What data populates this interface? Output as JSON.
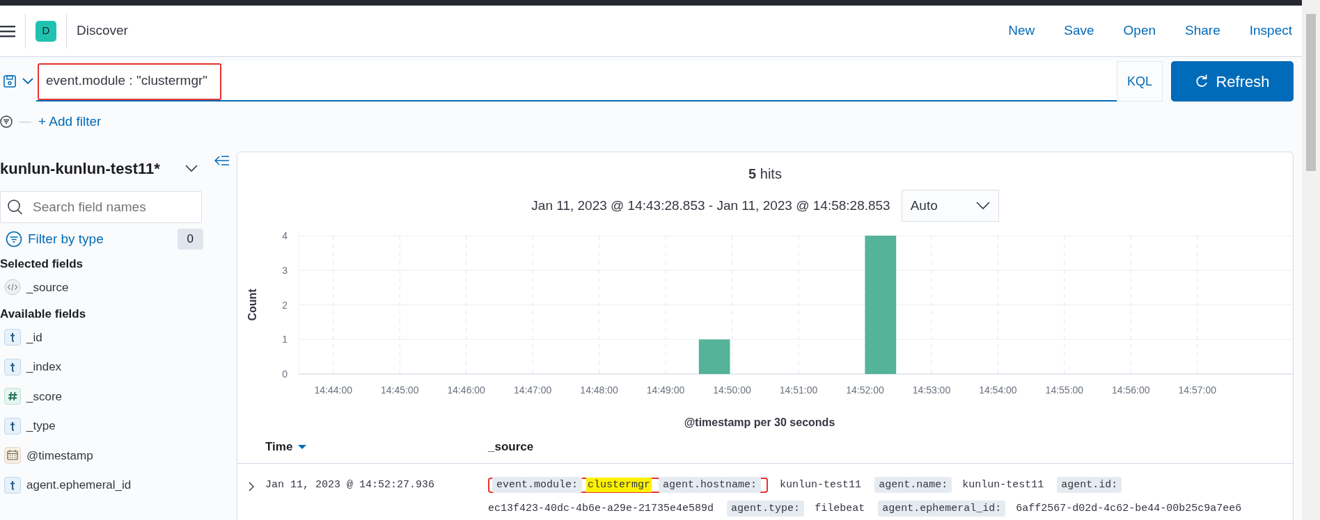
{
  "header": {
    "avatar": "D",
    "title": "Discover",
    "links": [
      "New",
      "Save",
      "Open",
      "Share",
      "Inspect"
    ]
  },
  "query": {
    "value": "event.module : \"clustermgr\"",
    "annotated": true,
    "language": "KQL",
    "refresh": "Refresh"
  },
  "filter_bar": {
    "dash": "—",
    "add_filter": "+ Add filter"
  },
  "sidebar": {
    "index_pattern": "kunlun-kunlun-test11*",
    "search": {
      "placeholder": "Search field names"
    },
    "filter_by_type": "Filter by type",
    "filter_count": "0",
    "selected_title": "Selected fields",
    "selected": [
      {
        "kind": "source",
        "name": "_source"
      }
    ],
    "available_title": "Available fields",
    "available": [
      {
        "kind": "string",
        "name": "_id"
      },
      {
        "kind": "string",
        "name": "_index"
      },
      {
        "kind": "number",
        "name": "_score"
      },
      {
        "kind": "string",
        "name": "_type"
      },
      {
        "kind": "date",
        "name": "@timestamp"
      },
      {
        "kind": "string",
        "name": "agent.ephemeral_id"
      }
    ]
  },
  "results": {
    "hits_count": "5",
    "hits_label": "hits",
    "time_range": "Jan 11, 2023 @ 14:43:28.853 - Jan 11, 2023 @ 14:58:28.853",
    "interval": "Auto",
    "chart_data": {
      "type": "bar",
      "xlabel": "@timestamp per 30 seconds",
      "ylabel": "Count",
      "categories": [
        null,
        "14:44:00",
        null,
        "14:45:00",
        null,
        "14:46:00",
        null,
        "14:47:00",
        null,
        "14:48:00",
        null,
        "14:49:00",
        null,
        "14:50:00",
        null,
        "14:51:00",
        null,
        "14:52:00",
        null,
        "14:53:00",
        null,
        "14:54:00",
        null,
        "14:55:00",
        null,
        "14:56:00",
        null,
        "14:57:00",
        null,
        null
      ],
      "values": [
        0,
        0,
        0,
        0,
        0,
        0,
        0,
        0,
        0,
        0,
        0,
        0,
        1,
        0,
        0,
        0,
        0,
        4,
        0,
        0,
        0,
        0,
        0,
        0,
        0,
        0,
        0,
        0,
        0,
        0
      ],
      "ylim": [
        0,
        4
      ],
      "grid": true,
      "yticks": [
        0,
        1,
        2,
        3,
        4
      ]
    },
    "table": {
      "columns": [
        {
          "label": "Time",
          "sorted": true
        },
        {
          "label": "_source",
          "sorted": false
        }
      ],
      "rows": [
        {
          "time": "Jan 11, 2023 @ 14:52:27.936",
          "fields": [
            {
              "key": "event.module:",
              "value": "clustermgr",
              "highlighted": true,
              "key_annotated": true,
              "value_annotated": true
            },
            {
              "key": "agent.hostname:",
              "value": "kunlun-test11",
              "highlighted": false,
              "key_annotated": true,
              "value_annotated": false
            },
            {
              "key": "agent.name:",
              "value": "kunlun-test11",
              "highlighted": false,
              "key_annotated": false,
              "value_annotated": false
            },
            {
              "key": "agent.id:",
              "value": "ec13f423-40dc-4b6e-a29e-21735e4e589d",
              "highlighted": false,
              "key_annotated": false,
              "value_annotated": false
            },
            {
              "key": "agent.type:",
              "value": "filebeat",
              "highlighted": false,
              "key_annotated": false,
              "value_annotated": false
            },
            {
              "key": "agent.ephemeral_id:",
              "value": "6aff2567-d02d-4c62-be44-00b25c9a7ee6",
              "highlighted": false,
              "key_annotated": false,
              "value_annotated": false
            }
          ]
        }
      ]
    }
  }
}
